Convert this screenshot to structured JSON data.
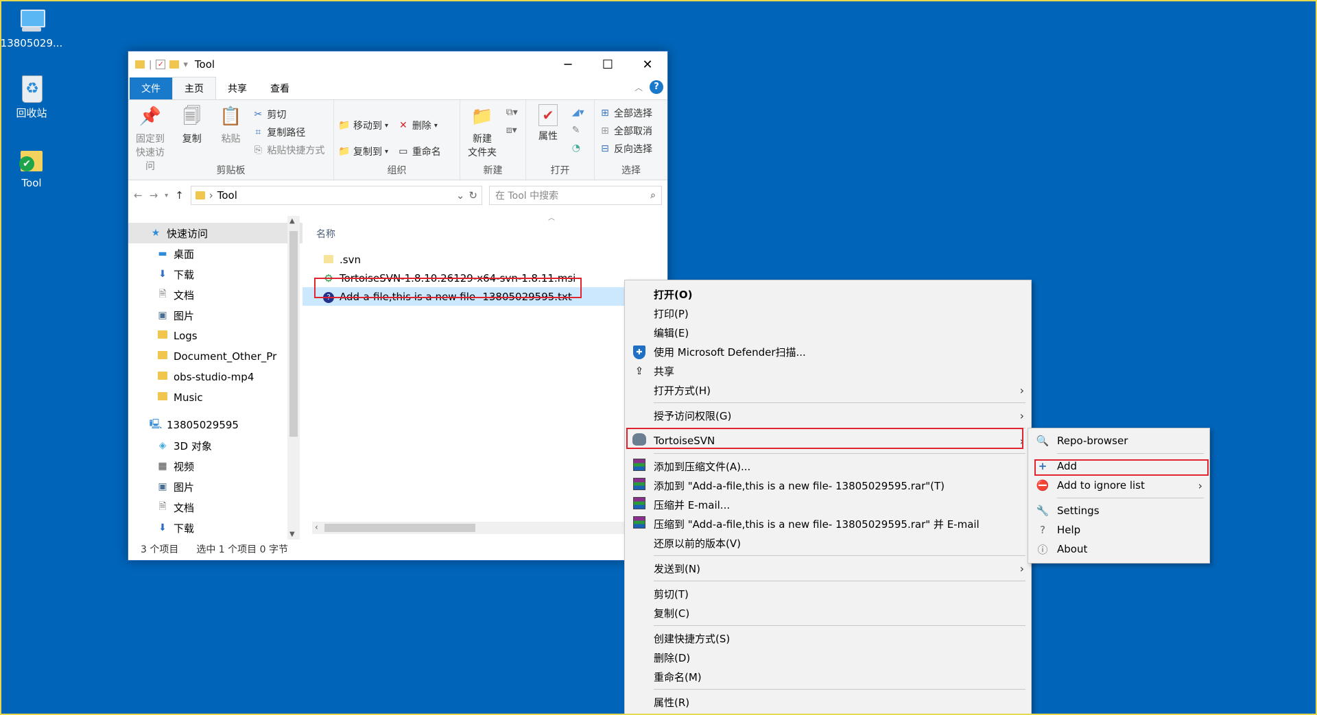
{
  "desktop": {
    "icons": [
      {
        "label": "13805029...",
        "icon": "computer-icon"
      },
      {
        "label": "回收站",
        "icon": "recycle-bin-icon"
      },
      {
        "label": "Tool",
        "icon": "svn-folder-icon"
      }
    ]
  },
  "window": {
    "title": "Tool",
    "controls": {
      "minimize": "─",
      "maximize": "☐",
      "close": "✕"
    },
    "tabs": {
      "file": "文件",
      "home": "主页",
      "share": "共享",
      "view": "查看"
    },
    "help": "?",
    "ribbon": {
      "clipboard": {
        "name": "剪贴板",
        "pin": "固定到\n快速访问",
        "pin1": "固定到",
        "pin2": "快速访问",
        "copy": "复制",
        "paste": "粘贴",
        "cut": "剪切",
        "copy_path": "复制路径",
        "paste_shortcut": "粘贴快捷方式"
      },
      "organize": {
        "name": "组织",
        "move_to": "移动到",
        "delete": "删除",
        "copy_to": "复制到",
        "rename": "重命名"
      },
      "new": {
        "name": "新建",
        "new_folder1": "新建",
        "new_folder2": "文件夹"
      },
      "open": {
        "name": "打开",
        "properties": "属性"
      },
      "select": {
        "name": "选择",
        "select_all": "全部选择",
        "select_none": "全部取消",
        "invert": "反向选择"
      }
    },
    "address": {
      "path": "Tool",
      "search_placeholder": "在 Tool 中搜索"
    },
    "nav": {
      "quick_access": "快速访问",
      "quick_items": [
        "桌面",
        "下载",
        "文档",
        "图片",
        "Logs",
        "Document_Other_Pr",
        "obs-studio-mp4",
        "Music"
      ],
      "this_pc": "13805029595",
      "pc_items": [
        "3D 对象",
        "视频",
        "图片",
        "文档",
        "下载"
      ]
    },
    "content": {
      "column_name": "名称",
      "files": [
        ".svn",
        "TortoiseSVN-1.8.10.26129-x64-svn-1.8.11.msi",
        "Add-a-file,this is a new file- 13805029595.txt"
      ]
    },
    "status": {
      "count": "3 个项目",
      "selected": "选中 1 个项目  0 字节"
    }
  },
  "context_menu": {
    "items": [
      "打开(O)",
      "打印(P)",
      "编辑(E)",
      "使用 Microsoft Defender扫描...",
      "共享",
      "打开方式(H)",
      "授予访问权限(G)",
      "TortoiseSVN",
      "添加到压缩文件(A)...",
      "添加到 \"Add-a-file,this is a new file- 13805029595.rar\"(T)",
      "压缩并 E-mail...",
      "压缩到 \"Add-a-file,this is a new file- 13805029595.rar\" 并 E-mail",
      "还原以前的版本(V)",
      "发送到(N)",
      "剪切(T)",
      "复制(C)",
      "创建快捷方式(S)",
      "删除(D)",
      "重命名(M)",
      "属性(R)"
    ]
  },
  "svn_submenu": {
    "items": [
      "Repo-browser",
      "Add",
      "Add to ignore list",
      "Settings",
      "Help",
      "About"
    ]
  },
  "colors": {
    "desktop": "#0064b8",
    "highlight": "#e0232e",
    "selection": "#cce8ff",
    "file_tab": "#1979ca"
  }
}
